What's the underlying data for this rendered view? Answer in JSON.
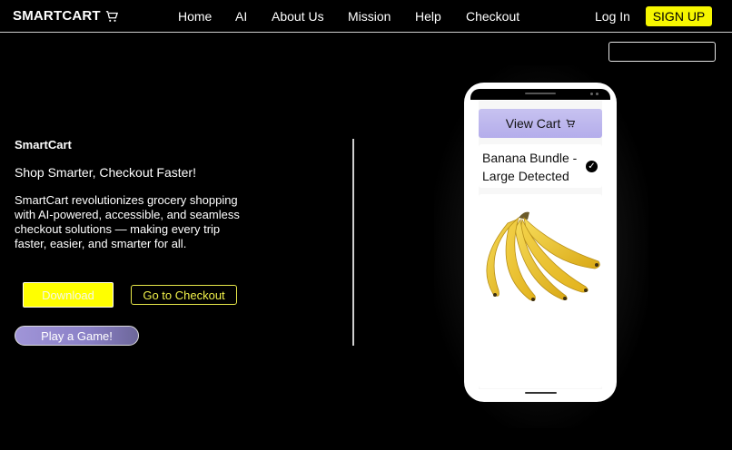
{
  "nav": {
    "brand": "SMARTCART",
    "links": [
      "Home",
      "AI",
      "About Us",
      "Mission",
      "Help",
      "Checkout"
    ],
    "login": "Log In",
    "signup": "SIGN UP"
  },
  "search": {
    "placeholder": ""
  },
  "hero": {
    "brand": "SmartCart",
    "tagline": "Shop Smarter, Checkout Faster!",
    "description": "SmartCart revolutionizes grocery shopping with AI-powered, accessible, and seamless checkout solutions — making every trip faster, easier, and smarter for all.",
    "download_label": "Download",
    "checkout_label": "Go to Checkout",
    "game_label": "Play a Game!"
  },
  "phone": {
    "view_cart": "View Cart",
    "detected_item": "Banana Bundle - Large Detected",
    "detected_mark": "✓"
  },
  "colors": {
    "accent_yellow": "#ffff00",
    "cart_purple": "#b4adeb",
    "background": "#000000"
  },
  "icons": [
    "cart-icon",
    "check-icon",
    "banana-image"
  ]
}
